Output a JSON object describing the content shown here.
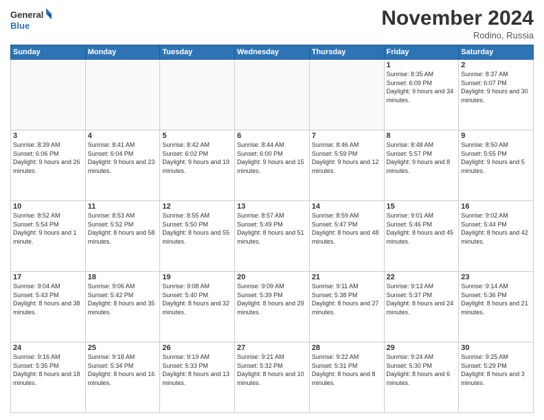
{
  "logo": {
    "line1": "General",
    "line2": "Blue"
  },
  "title": "November 2024",
  "location": "Rodino, Russia",
  "days_header": [
    "Sunday",
    "Monday",
    "Tuesday",
    "Wednesday",
    "Thursday",
    "Friday",
    "Saturday"
  ],
  "weeks": [
    [
      {
        "day": "",
        "info": ""
      },
      {
        "day": "",
        "info": ""
      },
      {
        "day": "",
        "info": ""
      },
      {
        "day": "",
        "info": ""
      },
      {
        "day": "",
        "info": ""
      },
      {
        "day": "1",
        "info": "Sunrise: 8:35 AM\nSunset: 6:09 PM\nDaylight: 9 hours and 34 minutes."
      },
      {
        "day": "2",
        "info": "Sunrise: 8:37 AM\nSunset: 6:07 PM\nDaylight: 9 hours and 30 minutes."
      }
    ],
    [
      {
        "day": "3",
        "info": "Sunrise: 8:39 AM\nSunset: 6:06 PM\nDaylight: 9 hours and 26 minutes."
      },
      {
        "day": "4",
        "info": "Sunrise: 8:41 AM\nSunset: 6:04 PM\nDaylight: 9 hours and 23 minutes."
      },
      {
        "day": "5",
        "info": "Sunrise: 8:42 AM\nSunset: 6:02 PM\nDaylight: 9 hours and 19 minutes."
      },
      {
        "day": "6",
        "info": "Sunrise: 8:44 AM\nSunset: 6:00 PM\nDaylight: 9 hours and 15 minutes."
      },
      {
        "day": "7",
        "info": "Sunrise: 8:46 AM\nSunset: 5:59 PM\nDaylight: 9 hours and 12 minutes."
      },
      {
        "day": "8",
        "info": "Sunrise: 8:48 AM\nSunset: 5:57 PM\nDaylight: 9 hours and 8 minutes."
      },
      {
        "day": "9",
        "info": "Sunrise: 8:50 AM\nSunset: 5:55 PM\nDaylight: 9 hours and 5 minutes."
      }
    ],
    [
      {
        "day": "10",
        "info": "Sunrise: 8:52 AM\nSunset: 5:54 PM\nDaylight: 9 hours and 1 minute."
      },
      {
        "day": "11",
        "info": "Sunrise: 8:53 AM\nSunset: 5:52 PM\nDaylight: 8 hours and 58 minutes."
      },
      {
        "day": "12",
        "info": "Sunrise: 8:55 AM\nSunset: 5:50 PM\nDaylight: 8 hours and 55 minutes."
      },
      {
        "day": "13",
        "info": "Sunrise: 8:57 AM\nSunset: 5:49 PM\nDaylight: 8 hours and 51 minutes."
      },
      {
        "day": "14",
        "info": "Sunrise: 8:59 AM\nSunset: 5:47 PM\nDaylight: 8 hours and 48 minutes."
      },
      {
        "day": "15",
        "info": "Sunrise: 9:01 AM\nSunset: 5:46 PM\nDaylight: 8 hours and 45 minutes."
      },
      {
        "day": "16",
        "info": "Sunrise: 9:02 AM\nSunset: 5:44 PM\nDaylight: 8 hours and 42 minutes."
      }
    ],
    [
      {
        "day": "17",
        "info": "Sunrise: 9:04 AM\nSunset: 5:43 PM\nDaylight: 8 hours and 38 minutes."
      },
      {
        "day": "18",
        "info": "Sunrise: 9:06 AM\nSunset: 5:42 PM\nDaylight: 8 hours and 35 minutes."
      },
      {
        "day": "19",
        "info": "Sunrise: 9:08 AM\nSunset: 5:40 PM\nDaylight: 8 hours and 32 minutes."
      },
      {
        "day": "20",
        "info": "Sunrise: 9:09 AM\nSunset: 5:39 PM\nDaylight: 8 hours and 29 minutes."
      },
      {
        "day": "21",
        "info": "Sunrise: 9:11 AM\nSunset: 5:38 PM\nDaylight: 8 hours and 27 minutes."
      },
      {
        "day": "22",
        "info": "Sunrise: 9:13 AM\nSunset: 5:37 PM\nDaylight: 8 hours and 24 minutes."
      },
      {
        "day": "23",
        "info": "Sunrise: 9:14 AM\nSunset: 5:36 PM\nDaylight: 8 hours and 21 minutes."
      }
    ],
    [
      {
        "day": "24",
        "info": "Sunrise: 9:16 AM\nSunset: 5:35 PM\nDaylight: 8 hours and 18 minutes."
      },
      {
        "day": "25",
        "info": "Sunrise: 9:18 AM\nSunset: 5:34 PM\nDaylight: 8 hours and 16 minutes."
      },
      {
        "day": "26",
        "info": "Sunrise: 9:19 AM\nSunset: 5:33 PM\nDaylight: 8 hours and 13 minutes."
      },
      {
        "day": "27",
        "info": "Sunrise: 9:21 AM\nSunset: 5:32 PM\nDaylight: 8 hours and 10 minutes."
      },
      {
        "day": "28",
        "info": "Sunrise: 9:22 AM\nSunset: 5:31 PM\nDaylight: 8 hours and 8 minutes."
      },
      {
        "day": "29",
        "info": "Sunrise: 9:24 AM\nSunset: 5:30 PM\nDaylight: 8 hours and 6 minutes."
      },
      {
        "day": "30",
        "info": "Sunrise: 9:25 AM\nSunset: 5:29 PM\nDaylight: 8 hours and 3 minutes."
      }
    ]
  ]
}
